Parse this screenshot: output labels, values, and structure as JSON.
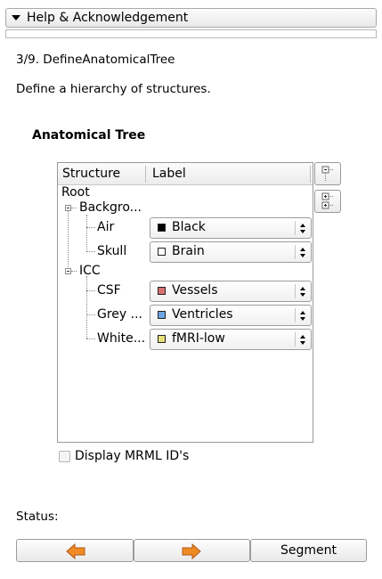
{
  "help": {
    "label": "Help & Acknowledgement"
  },
  "step": {
    "title": "3/9. DefineAnatomicalTree",
    "description": "Define a hierarchy of structures."
  },
  "tree": {
    "heading": "Anatomical Tree",
    "columns": {
      "structure": "Structure",
      "label": "Label"
    },
    "root": "Root",
    "nodes": [
      {
        "name": "Backgro...",
        "children": [
          {
            "name": "Air",
            "label": "Black",
            "color": "#000000"
          },
          {
            "name": "Skull",
            "label": "Brain",
            "color": "#ffffff"
          }
        ]
      },
      {
        "name": "ICC",
        "children": [
          {
            "name": "CSF",
            "label": "Vessels",
            "color": "#d97070"
          },
          {
            "name": "Grey ...",
            "label": "Ventricles",
            "color": "#6ea4e6"
          },
          {
            "name": "White...",
            "label": "fMRI-low",
            "color": "#e8e07a"
          }
        ]
      }
    ]
  },
  "display_mrml": {
    "label": "Display MRML ID's",
    "checked": false
  },
  "status": {
    "label": "Status:"
  },
  "nav": {
    "segment_label": "Segment"
  },
  "colors": {
    "arrow": "#f08a24"
  }
}
